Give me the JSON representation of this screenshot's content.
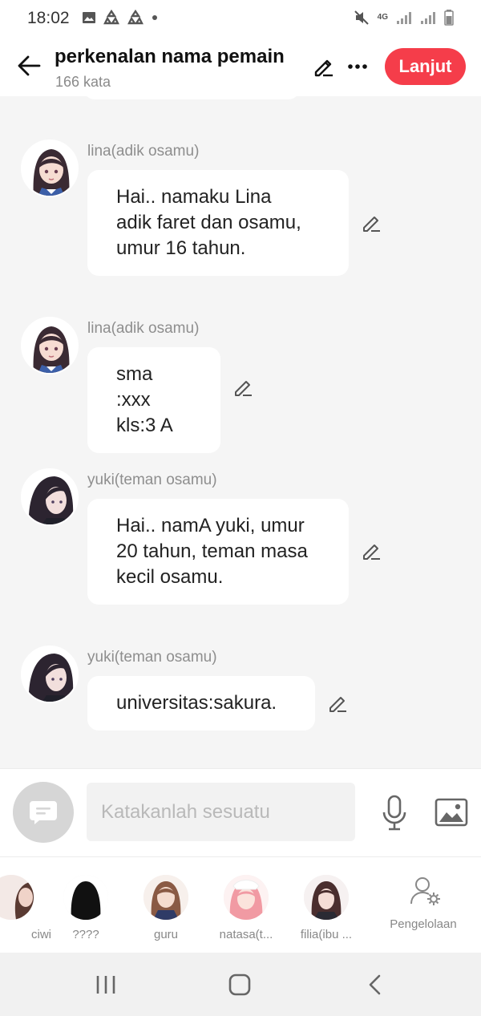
{
  "status_bar": {
    "time": "18:02",
    "network_label": "4G",
    "left_icons": [
      "gallery-notification-icon",
      "recycle-notification-icon",
      "recycle-notification-icon",
      "dot-icon"
    ],
    "right_icons": [
      "mute-icon",
      "signal-icon",
      "signal-icon",
      "battery-icon"
    ]
  },
  "header": {
    "title": "perkenalan nama pemain",
    "word_count": "166 kata",
    "next_label": "Lanjut",
    "accent_color": "#f53d4a"
  },
  "messages": [
    {
      "speaker": "lina(adik osamu)",
      "lines": [
        "Hai.. namaku Lina",
        "adik faret dan osamu,",
        "umur 16 tahun."
      ],
      "avatar": "lina-avatar"
    },
    {
      "speaker": "lina(adik osamu)",
      "lines": [
        "sma :xxx",
        "kls:3 A"
      ],
      "avatar": "lina-avatar"
    },
    {
      "speaker": "yuki(teman osamu)",
      "lines": [
        "Hai.. namA yuki, umur",
        "20 tahun, teman masa",
        "kecil osamu."
      ],
      "avatar": "yuki-avatar"
    },
    {
      "speaker": "yuki(teman osamu)",
      "lines": [
        "universitas:sakura."
      ],
      "avatar": "yuki-avatar"
    }
  ],
  "input": {
    "placeholder": "Katakanlah sesuatu"
  },
  "characters": [
    {
      "name": "ciwi"
    },
    {
      "name": "????"
    },
    {
      "name": "guru"
    },
    {
      "name": "natasa(t..."
    },
    {
      "name": "filia(ibu ..."
    }
  ],
  "manage_label": "Pengelolaan"
}
